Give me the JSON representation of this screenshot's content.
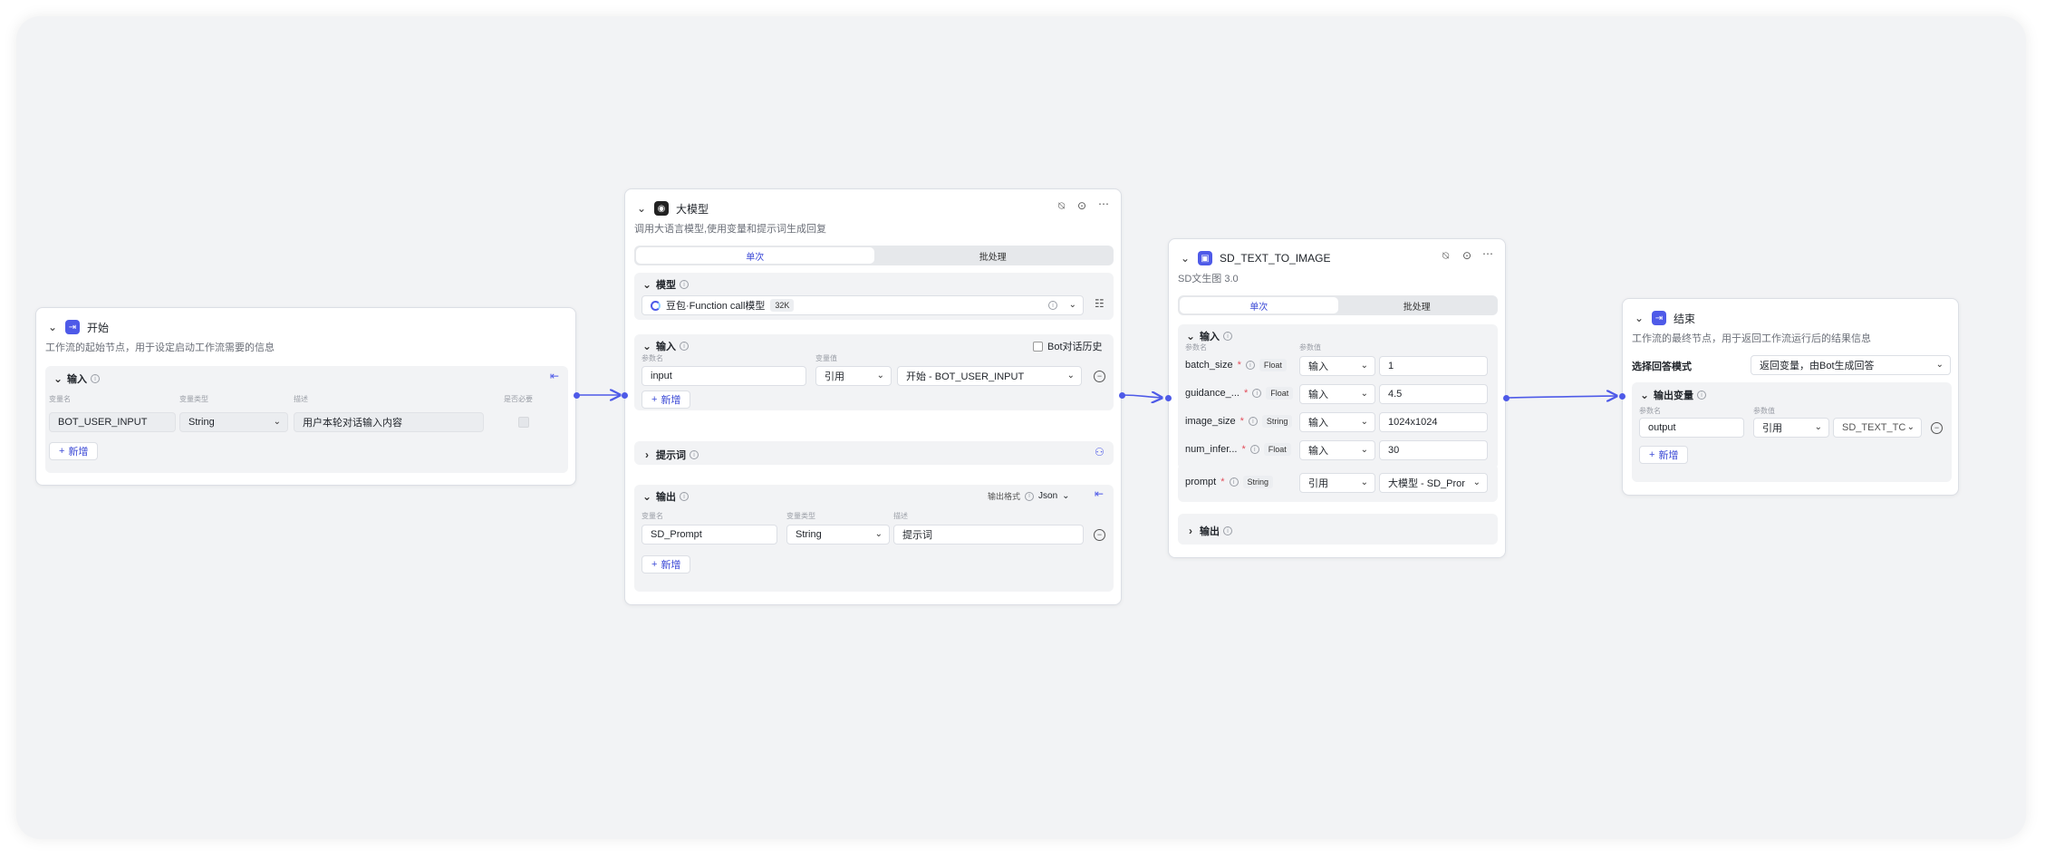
{
  "start": {
    "title": "开始",
    "desc": "工作流的起始节点，用于设定启动工作流需要的信息",
    "input_title": "输入",
    "col_name": "变量名",
    "col_type": "变量类型",
    "col_desc": "描述",
    "col_required": "是否必要",
    "row": {
      "name": "BOT_USER_INPUT",
      "type": "String",
      "desc": "用户本轮对话输入内容"
    },
    "add": "新增"
  },
  "llm": {
    "title": "大模型",
    "desc": "调用大语言模型,使用变量和提示词生成回复",
    "tab_single": "单次",
    "tab_batch": "批处理",
    "model_title": "模型",
    "model_name": "豆包·Function call模型",
    "model_badge": "32K",
    "input_title": "输入",
    "bot_history": "Bot对话历史",
    "col_param": "参数名",
    "col_value": "变量值",
    "input_row": {
      "name": "input",
      "mode": "引用",
      "value": "开始 - BOT_USER_INPUT"
    },
    "add": "新增",
    "prompt_title": "提示词",
    "output_title": "输出",
    "output_format_label": "输出格式",
    "output_format": "Json",
    "col_var": "变量名",
    "col_type": "变量类型",
    "col_desc": "描述",
    "output_row": {
      "name": "SD_Prompt",
      "type": "String",
      "desc": "提示词"
    }
  },
  "sd": {
    "title": "SD_TEXT_TO_IMAGE",
    "desc": "SD文生图 3.0",
    "tab_single": "单次",
    "tab_batch": "批处理",
    "input_title": "输入",
    "col_param": "参数名",
    "col_value": "参数值",
    "rows": [
      {
        "name": "batch_size",
        "type": "Float",
        "mode": "输入",
        "value": "1"
      },
      {
        "name": "guidance_...",
        "type": "Float",
        "mode": "输入",
        "value": "4.5"
      },
      {
        "name": "image_size",
        "type": "String",
        "mode": "输入",
        "value": "1024x1024"
      },
      {
        "name": "num_infer...",
        "type": "Float",
        "mode": "输入",
        "value": "30"
      },
      {
        "name": "prompt",
        "type": "String",
        "mode": "引用",
        "value": "大模型 - SD_Pror"
      }
    ],
    "output_title": "输出"
  },
  "end": {
    "title": "结束",
    "desc": "工作流的最终节点，用于返回工作流运行后的结果信息",
    "answer_mode_label": "选择回答模式",
    "answer_mode": "返回变量，由Bot生成回答",
    "output_title": "输出变量",
    "col_param": "参数名",
    "col_value": "参数值",
    "row": {
      "name": "output",
      "mode": "引用",
      "value": "SD_TEXT_TC"
    },
    "add": "新增"
  },
  "colors": {
    "accent": "#3c4ad6",
    "edge": "#4e5ae8",
    "canvas": "#f2f3f5"
  }
}
